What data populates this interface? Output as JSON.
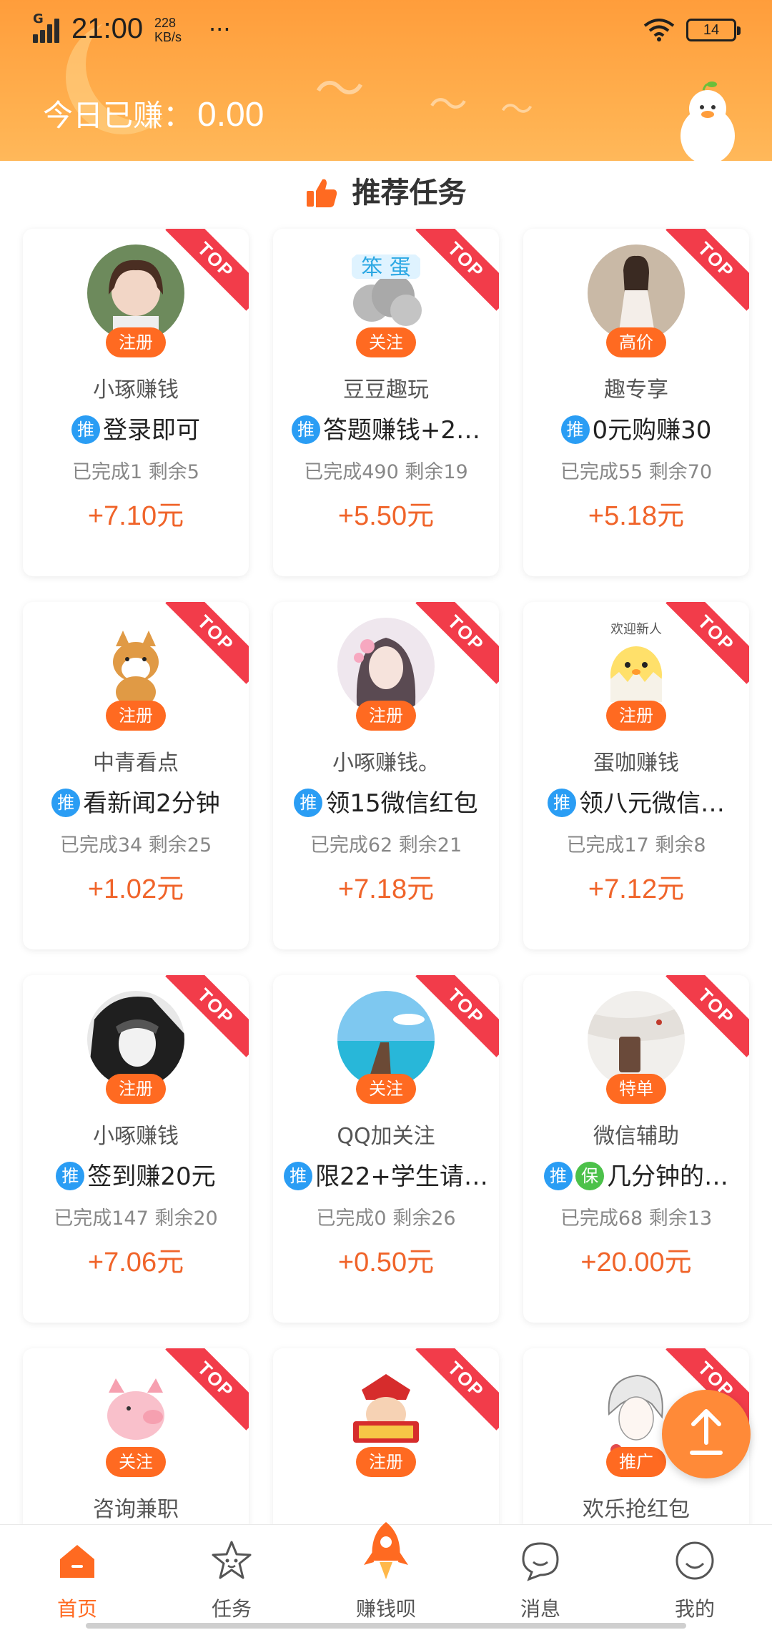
{
  "status_bar": {
    "network": "G",
    "time": "21:00",
    "speed_value": "228",
    "speed_unit": "KB/s",
    "more": "···",
    "battery": "14"
  },
  "header": {
    "earned_label": "今日已赚：",
    "earned_value": "0.00"
  },
  "section": {
    "title": "推荐任务"
  },
  "cards": [
    {
      "name": "小琢赚钱",
      "tag": "注册",
      "badges": [
        "推"
      ],
      "task": "登录即可",
      "stats": "已完成1 剩余5",
      "reward": "+7.10元",
      "ribbon": "TOP"
    },
    {
      "name": "豆豆趣玩",
      "tag": "关注",
      "badges": [
        "推"
      ],
      "task": "答题赚钱+2…",
      "stats": "已完成490 剩余19",
      "reward": "+5.50元",
      "ribbon": "TOP"
    },
    {
      "name": "趣专享",
      "tag": "高价",
      "badges": [
        "推"
      ],
      "task": "0元购赚30",
      "stats": "已完成55 剩余70",
      "reward": "+5.18元",
      "ribbon": "TOP"
    },
    {
      "name": "中青看点",
      "tag": "注册",
      "badges": [
        "推"
      ],
      "task": "看新闻2分钟",
      "stats": "已完成34 剩余25",
      "reward": "+1.02元",
      "ribbon": "TOP"
    },
    {
      "name": "小啄赚钱。",
      "tag": "注册",
      "badges": [
        "推"
      ],
      "task": "领15微信红包",
      "stats": "已完成62 剩余21",
      "reward": "+7.18元",
      "ribbon": "TOP"
    },
    {
      "name": "蛋咖赚钱",
      "tag": "注册",
      "badges": [
        "推"
      ],
      "task": "领八元微信…",
      "stats": "已完成17 剩余8",
      "reward": "+7.12元",
      "ribbon": "TOP",
      "avatar_caption": "欢迎新人"
    },
    {
      "name": "小啄赚钱",
      "tag": "注册",
      "badges": [
        "推"
      ],
      "task": "签到赚20元",
      "stats": "已完成147 剩余20",
      "reward": "+7.06元",
      "ribbon": "TOP"
    },
    {
      "name": "QQ加关注",
      "tag": "关注",
      "badges": [
        "推"
      ],
      "task": "限22+学生请…",
      "stats": "已完成0 剩余26",
      "reward": "+0.50元",
      "ribbon": "TOP"
    },
    {
      "name": "微信辅助",
      "tag": "特单",
      "badges": [
        "推",
        "保"
      ],
      "task": "几分钟的…",
      "stats": "已完成68 剩余13",
      "reward": "+20.00元",
      "ribbon": "TOP"
    },
    {
      "name": "咨询兼职",
      "tag": "关注",
      "badges": [],
      "task": "",
      "stats": "",
      "reward": "",
      "ribbon": "TOP"
    },
    {
      "name": "",
      "tag": "注册",
      "badges": [],
      "task": "",
      "stats": "",
      "reward": "",
      "ribbon": "TOP"
    },
    {
      "name": "欢乐抢红包",
      "tag": "推广",
      "badges": [],
      "task": "",
      "stats": "",
      "reward": "",
      "ribbon": "TOP"
    }
  ],
  "nav": {
    "items": [
      {
        "label": "首页",
        "icon": "home-icon",
        "active": true
      },
      {
        "label": "任务",
        "icon": "star-face-icon",
        "active": false
      },
      {
        "label": "赚钱呗",
        "icon": "rocket-icon",
        "active": false
      },
      {
        "label": "消息",
        "icon": "message-icon",
        "active": false
      },
      {
        "label": "我的",
        "icon": "smile-face-icon",
        "active": false
      }
    ]
  },
  "colors": {
    "header": "#ff9d3b",
    "accent": "#ff6a21",
    "reward": "#f0642a",
    "ribbon": "#f23c4a",
    "badge_blue": "#2a9df4",
    "badge_green": "#4cc14a"
  }
}
